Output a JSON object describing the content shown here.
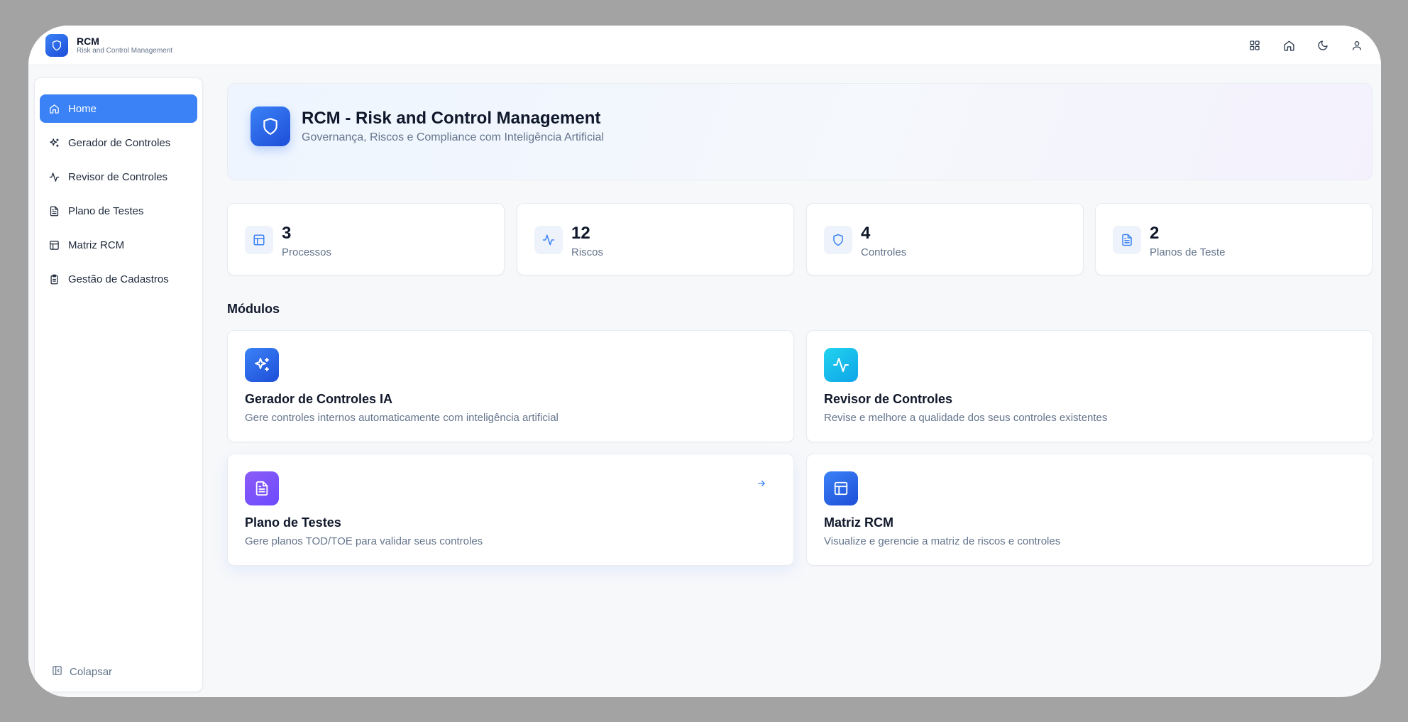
{
  "app": {
    "title": "RCM",
    "subtitle": "Risk and Control Management"
  },
  "sidebar": {
    "items": [
      {
        "label": "Home",
        "icon": "home-icon",
        "active": true
      },
      {
        "label": "Gerador de Controles",
        "icon": "sparkles-icon"
      },
      {
        "label": "Revisor de Controles",
        "icon": "activity-icon"
      },
      {
        "label": "Plano de Testes",
        "icon": "file-text-icon"
      },
      {
        "label": "Matriz RCM",
        "icon": "table-icon"
      },
      {
        "label": "Gestão de Cadastros",
        "icon": "clipboard-icon"
      }
    ],
    "collapse_label": "Colapsar"
  },
  "hero": {
    "title": "RCM - Risk and Control Management",
    "subtitle": "Governança, Riscos e Compliance com Inteligência Artificial"
  },
  "stats": [
    {
      "value": "3",
      "label": "Processos",
      "icon": "table-icon"
    },
    {
      "value": "12",
      "label": "Riscos",
      "icon": "activity-icon"
    },
    {
      "value": "4",
      "label": "Controles",
      "icon": "shield-icon"
    },
    {
      "value": "2",
      "label": "Planos de Teste",
      "icon": "file-text-icon"
    }
  ],
  "modules_title": "Módulos",
  "modules": [
    {
      "title": "Gerador de Controles IA",
      "description": "Gere controles internos automaticamente com inteligência artificial",
      "icon": "sparkles-icon"
    },
    {
      "title": "Revisor de Controles",
      "description": "Revise e melhore a qualidade dos seus controles existentes",
      "icon": "activity-icon"
    },
    {
      "title": "Plano de Testes",
      "description": "Gere planos TOD/TOE para validar seus controles",
      "icon": "file-text-icon"
    },
    {
      "title": "Matriz RCM",
      "description": "Visualize e gerencie a matriz de riscos e controles",
      "icon": "table-icon"
    }
  ],
  "colors": {
    "accent": "#3b82f6",
    "accent_dark": "#1d4ed8",
    "cyan": "#06b6d4",
    "violet": "#8b5cf6",
    "text": "#0f172a",
    "muted": "#64748b"
  }
}
